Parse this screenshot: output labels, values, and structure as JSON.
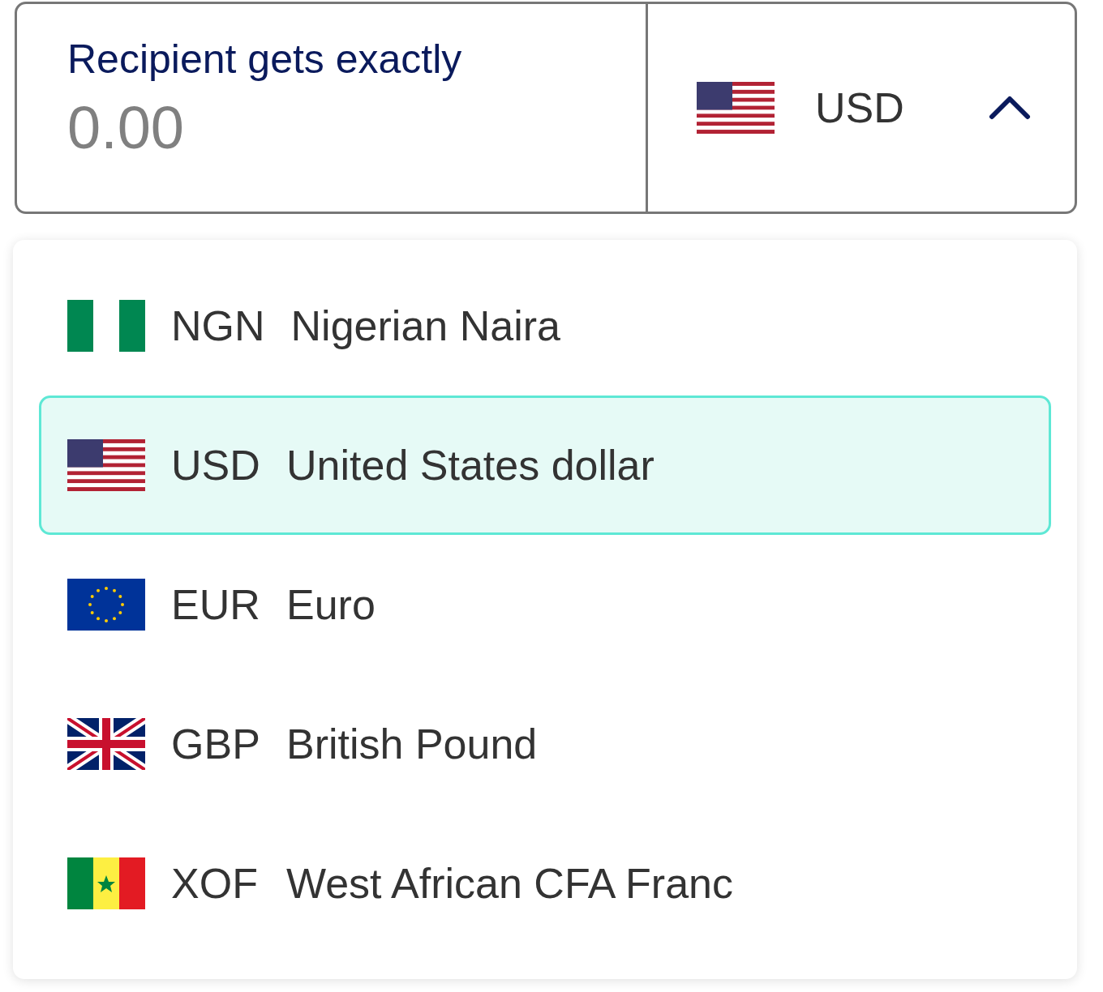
{
  "amount_field": {
    "label": "Recipient gets exactly",
    "placeholder": "0.00"
  },
  "currency_select": {
    "code": "USD",
    "kind": "us",
    "expanded": true
  },
  "options": [
    {
      "code": "NGN",
      "name": "Nigerian Naira",
      "kind": "ng",
      "selected": false
    },
    {
      "code": "USD",
      "name": "United States dollar",
      "kind": "us",
      "selected": true
    },
    {
      "code": "EUR",
      "name": "Euro",
      "kind": "eu",
      "selected": false
    },
    {
      "code": "GBP",
      "name": "British Pound",
      "kind": "gb",
      "selected": false
    },
    {
      "code": "XOF",
      "name": "West African CFA Franc",
      "kind": "sn",
      "selected": false
    }
  ]
}
